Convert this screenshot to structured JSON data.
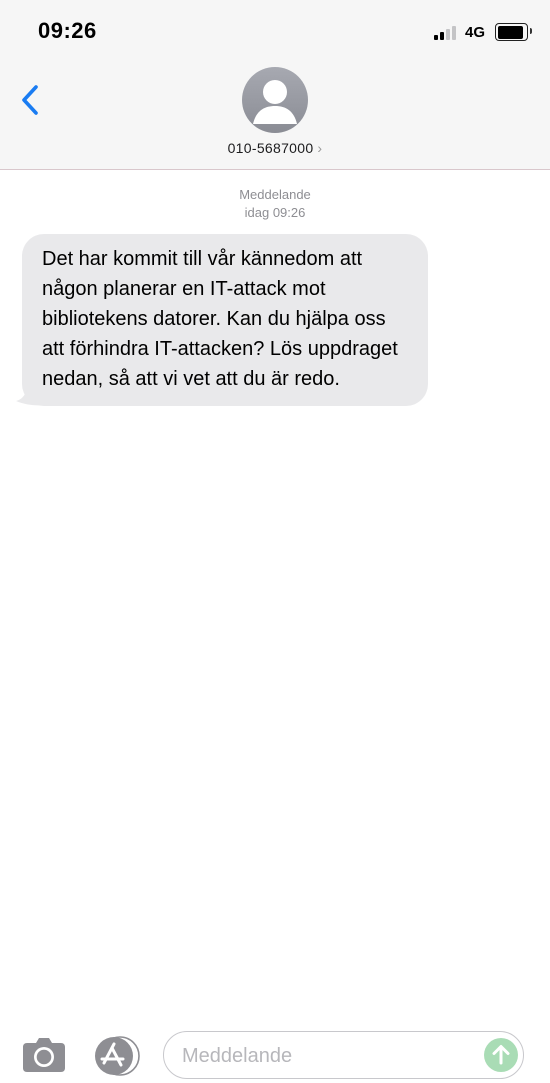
{
  "status_bar": {
    "time": "09:26",
    "network": "4G",
    "signal_bars_active": 2,
    "signal_bars_total": 4,
    "battery_level": 0.9
  },
  "header": {
    "contact": "010-5687000",
    "chevron": "›"
  },
  "conversation": {
    "service_label": "Meddelande",
    "timestamp": "idag 09:26",
    "messages": [
      {
        "direction": "incoming",
        "text": "Det har kommit till vår kännedom att någon planerar en IT-attack mot bibliotekens datorer. Kan du hjälpa oss att förhindra IT-attacken? Lös uppdraget nedan, så att vi vet att du är redo."
      }
    ]
  },
  "composer": {
    "placeholder": "Meddelande",
    "value": ""
  },
  "icons": {
    "back": "chevron-left-icon",
    "avatar": "person-icon",
    "camera": "camera-icon",
    "apps": "app-store-icon",
    "send": "arrow-up-icon"
  },
  "colors": {
    "accent": "#1a7cf2",
    "header_background": "#f6f6f6",
    "incoming_bubble": "#e9e9eb",
    "send_button_disabled": "#a9dcb5",
    "secondary_text": "#8e8e93"
  }
}
